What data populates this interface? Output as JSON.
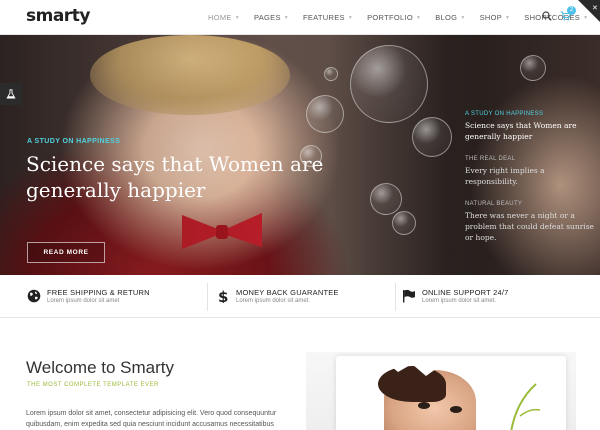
{
  "logo": "smarty",
  "nav": [
    {
      "label": "HOME",
      "active": true
    },
    {
      "label": "PAGES"
    },
    {
      "label": "FEATURES"
    },
    {
      "label": "PORTFOLIO"
    },
    {
      "label": "BLOG"
    },
    {
      "label": "SHOP"
    },
    {
      "label": "SHORTCODES"
    }
  ],
  "cart_count": "2",
  "hero": {
    "kicker": "A STUDY ON HAPPINESS",
    "title": "Science says that Women are generally happier",
    "button": "READ MORE"
  },
  "side_list": [
    {
      "kicker": "A STUDY ON HAPPINESS",
      "text": "Science says that Women are generally happier",
      "active": true
    },
    {
      "kicker": "THE REAL DEAL",
      "text": "Every right implies a responsibility."
    },
    {
      "kicker": "NATURAL BEAUTY",
      "text": "There was never a night or a problem that could defeat sunrise or hope."
    }
  ],
  "features": [
    {
      "icon": "globe-icon",
      "title": "FREE SHIPPING & RETURN",
      "sub": "Lorem ipsum dolor sit amet"
    },
    {
      "icon": "dollar-icon",
      "title": "MONEY BACK GUARANTEE",
      "sub": "Lorem ipsum dolor sit amet."
    },
    {
      "icon": "flag-icon",
      "title": "ONLINE SUPPORT 24/7",
      "sub": "Lorem ipsum dolor sit amet."
    }
  ],
  "welcome": {
    "title": "Welcome to Smarty",
    "subtitle": "THE MOST COMPLETE TEMPLATE EVER",
    "body": "Lorem ipsum dolor sit amet, consectetur adipisicing elit. Vero quod consequuntur quibusdam, enim expedita sed quia nesciunt incidunt accusamus necessitatibus"
  },
  "colors": {
    "accent": "#4fd1e0",
    "green": "#9bbb3a",
    "badge": "#4fc1e9"
  }
}
